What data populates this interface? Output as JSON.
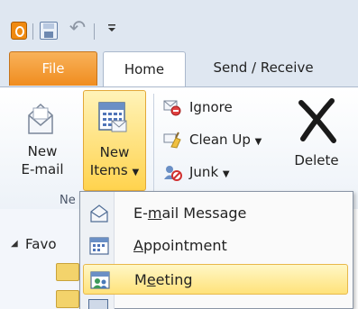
{
  "tabs": {
    "file": "File",
    "home": "Home",
    "send_receive": "Send / Receive"
  },
  "ribbon": {
    "new_email": {
      "line1": "New",
      "line2": "E-mail"
    },
    "new_items": {
      "line1": "New",
      "line2": "Items"
    },
    "group_label": "Ne",
    "ignore": "Ignore",
    "clean_up": "Clean Up",
    "junk": "Junk",
    "delete": "Delete"
  },
  "pane": {
    "favorites": "Favo"
  },
  "menu": {
    "items": [
      {
        "pre": "E-",
        "accel": "m",
        "post": "ail Message"
      },
      {
        "pre": "",
        "accel": "A",
        "post": "ppointment"
      },
      {
        "pre": "M",
        "accel": "e",
        "post": "eting"
      }
    ]
  },
  "colors": {
    "file_tab": "#f08d1f",
    "highlight": "#ffd34e",
    "ribbon_bg": "#dfe7f1"
  },
  "icons": {
    "office": "office-logo-icon",
    "save": "save-icon",
    "undo": "undo-icon",
    "qat_customize": "customize-dropdown-icon"
  }
}
